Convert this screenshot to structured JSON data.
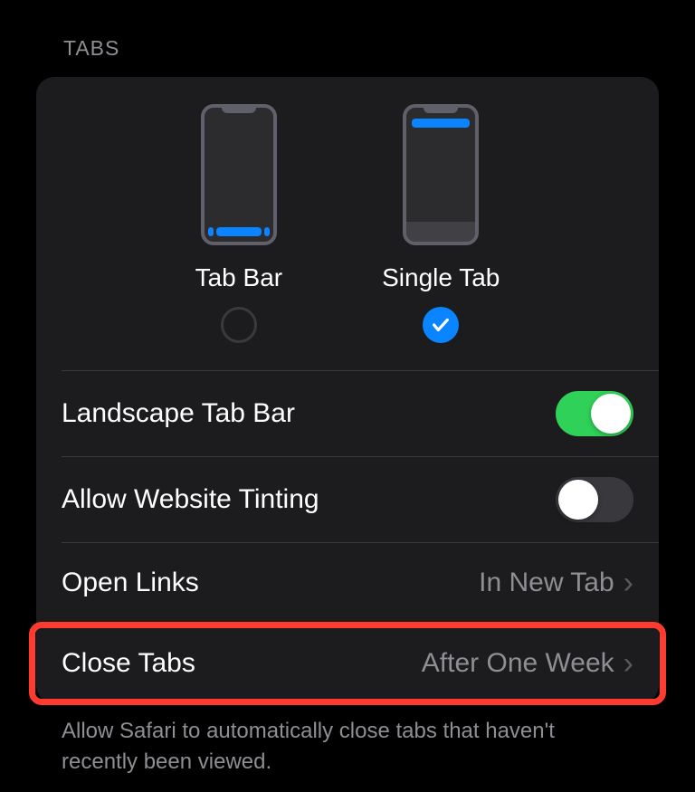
{
  "section": {
    "header": "TABS"
  },
  "layout": {
    "options": [
      {
        "label": "Tab Bar",
        "selected": false
      },
      {
        "label": "Single Tab",
        "selected": true
      }
    ]
  },
  "rows": {
    "landscape_tab_bar": {
      "label": "Landscape Tab Bar",
      "enabled": true
    },
    "allow_website_tinting": {
      "label": "Allow Website Tinting",
      "enabled": false
    },
    "open_links": {
      "label": "Open Links",
      "value": "In New Tab"
    },
    "close_tabs": {
      "label": "Close Tabs",
      "value": "After One Week"
    }
  },
  "footer": "Allow Safari to automatically close tabs that haven't recently been viewed."
}
